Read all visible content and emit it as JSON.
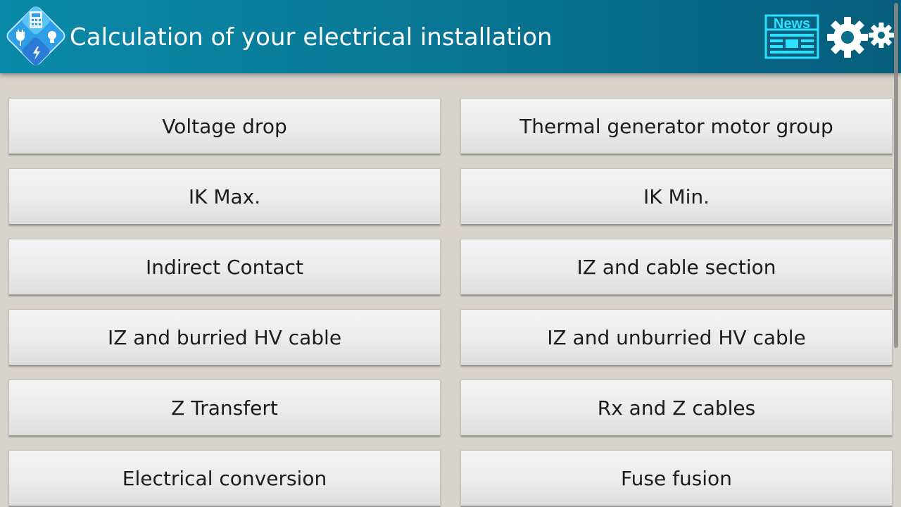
{
  "header": {
    "title": "Calculation of your electrical installation",
    "logo_icon": "electrical-calculator-logo-icon",
    "news_icon": "news-icon",
    "news_label": "News",
    "settings_icon": "gears-icon",
    "color": "#0a8aa8"
  },
  "menu": {
    "items": [
      {
        "label": "Voltage drop"
      },
      {
        "label": "Thermal generator motor group"
      },
      {
        "label": "IK Max."
      },
      {
        "label": "IK Min."
      },
      {
        "label": "Indirect Contact"
      },
      {
        "label": "IZ and cable section"
      },
      {
        "label": "IZ and burried HV cable"
      },
      {
        "label": "IZ and unburried HV cable"
      },
      {
        "label": "Z Transfert"
      },
      {
        "label": "Rx and Z cables"
      },
      {
        "label": "Electrical conversion"
      },
      {
        "label": "Fuse fusion"
      }
    ]
  },
  "colors": {
    "header": "#0a8aa8",
    "background": "#d8d4cc",
    "button": "#ebebeb",
    "news": "#2ee0ff"
  }
}
